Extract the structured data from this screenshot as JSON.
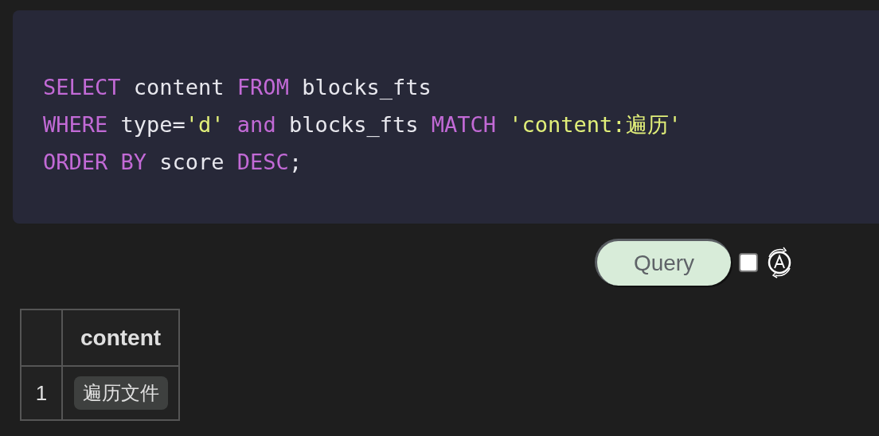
{
  "code": {
    "lines": [
      {
        "tokens": [
          {
            "kind": "keyword",
            "text": "SELECT"
          },
          {
            "kind": "plain",
            "text": " content "
          },
          {
            "kind": "keyword",
            "text": "FROM"
          },
          {
            "kind": "plain",
            "text": " blocks_fts"
          }
        ]
      },
      {
        "tokens": [
          {
            "kind": "keyword",
            "text": "WHERE"
          },
          {
            "kind": "plain",
            "text": " type="
          },
          {
            "kind": "string",
            "text": "'d'"
          },
          {
            "kind": "keyword",
            "text": " and"
          },
          {
            "kind": "plain",
            "text": " blocks_fts "
          },
          {
            "kind": "keyword",
            "text": "MATCH"
          },
          {
            "kind": "string",
            "text": " 'content:遍历'"
          }
        ]
      },
      {
        "tokens": [
          {
            "kind": "keyword",
            "text": "ORDER BY"
          },
          {
            "kind": "plain",
            "text": " score "
          },
          {
            "kind": "keyword",
            "text": "DESC"
          },
          {
            "kind": "plain",
            "text": ";"
          }
        ]
      }
    ]
  },
  "query_button": {
    "label": "Query"
  },
  "auto_checkbox": {
    "checked": false
  },
  "table": {
    "columns": [
      {
        "label": "content"
      }
    ],
    "rows": [
      {
        "index": "1",
        "cells": [
          "遍历文件"
        ]
      }
    ]
  }
}
